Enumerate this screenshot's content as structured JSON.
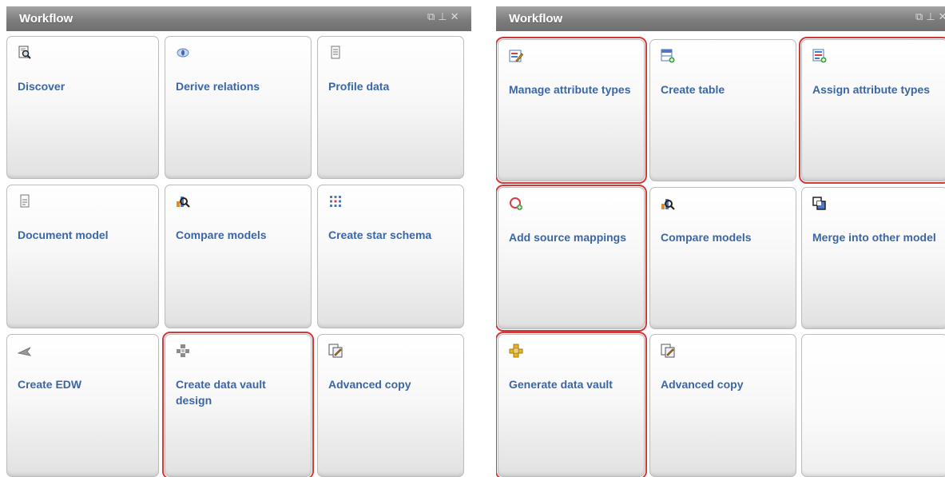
{
  "colors": {
    "link": "#3b66a6",
    "highlight": "#d23a3a",
    "titlebar": "#7d7d7d"
  },
  "left_panel": {
    "title": "Workflow",
    "controls": [
      "⧉",
      "⊥",
      "✕"
    ],
    "tiles": [
      {
        "label": "Discover",
        "icon": "discover-icon",
        "highlighted": false
      },
      {
        "label": "Derive relations",
        "icon": "derive-relations-icon",
        "highlighted": false
      },
      {
        "label": "Profile data",
        "icon": "profile-data-icon",
        "highlighted": false
      },
      {
        "label": "Document model",
        "icon": "document-model-icon",
        "highlighted": false
      },
      {
        "label": "Compare models",
        "icon": "compare-models-icon",
        "highlighted": false
      },
      {
        "label": "Create star schema",
        "icon": "star-schema-icon",
        "highlighted": false
      },
      {
        "label": "Create EDW",
        "icon": "create-edw-icon",
        "highlighted": false
      },
      {
        "label": "Create data vault design",
        "icon": "data-vault-design-icon",
        "highlighted": true
      },
      {
        "label": "Advanced copy",
        "icon": "advanced-copy-icon",
        "highlighted": false
      }
    ]
  },
  "right_panel": {
    "title": "Workflow",
    "controls": [
      "⧉",
      "⊥",
      "✕"
    ],
    "tiles": [
      {
        "label": "Manage attribute types",
        "icon": "manage-attribute-types-icon",
        "highlighted": true
      },
      {
        "label": "Create table",
        "icon": "create-table-icon",
        "highlighted": false
      },
      {
        "label": "Assign attribute types",
        "icon": "assign-attribute-types-icon",
        "highlighted": true
      },
      {
        "label": "Add source mappings",
        "icon": "add-source-mappings-icon",
        "highlighted": true
      },
      {
        "label": "Compare models",
        "icon": "compare-models-icon",
        "highlighted": false
      },
      {
        "label": "Merge into other model",
        "icon": "merge-model-icon",
        "highlighted": false
      },
      {
        "label": "Generate data vault",
        "icon": "generate-data-vault-icon",
        "highlighted": true
      },
      {
        "label": "Advanced copy",
        "icon": "advanced-copy-icon",
        "highlighted": false
      },
      {
        "label": "",
        "icon": "",
        "highlighted": false
      }
    ]
  }
}
